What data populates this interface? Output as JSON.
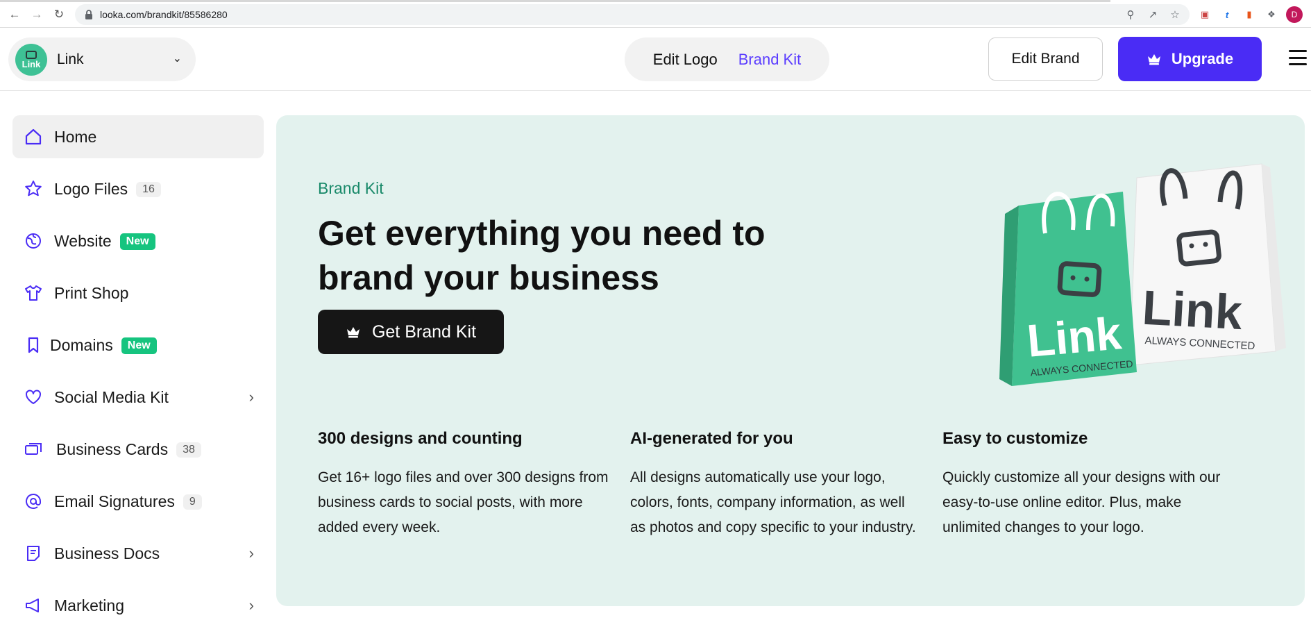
{
  "browser": {
    "url": "looka.com/brandkit/85586280",
    "profile_initial": "D"
  },
  "header": {
    "brand_logo_text": "Link",
    "brand_name": "Link",
    "tabs": [
      {
        "label": "Edit Logo"
      },
      {
        "label": "Brand Kit",
        "active": true
      }
    ],
    "edit_brand_label": "Edit Brand",
    "upgrade_label": "Upgrade",
    "accent_color": "#4a2cf5"
  },
  "sidebar": {
    "items": [
      {
        "label": "Home",
        "icon": "home-icon",
        "active": true
      },
      {
        "label": "Logo Files",
        "icon": "star-icon",
        "badge": "16"
      },
      {
        "label": "Website",
        "icon": "globe-icon",
        "badge": "New"
      },
      {
        "label": "Print Shop",
        "icon": "tshirt-icon"
      },
      {
        "label": "Domains",
        "icon": "bookmark-icon",
        "badge": "New"
      },
      {
        "label": "Social Media Kit",
        "icon": "heart-icon",
        "chevron": true
      },
      {
        "label": "Business Cards",
        "icon": "cards-icon",
        "badge": "38"
      },
      {
        "label": "Email Signatures",
        "icon": "at-icon",
        "badge": "9"
      },
      {
        "label": "Business Docs",
        "icon": "document-icon",
        "chevron": true
      },
      {
        "label": "Marketing",
        "icon": "megaphone-icon",
        "chevron": true
      }
    ]
  },
  "hero": {
    "kicker": "Brand Kit",
    "title_line1": "Get everything you need to",
    "title_line2": "brand your business",
    "cta_label": "Get Brand Kit",
    "bag_green": {
      "brand": "Link",
      "tagline": "ALWAYS CONNECTED"
    },
    "bag_white": {
      "brand": "Link",
      "tagline": "ALWAYS CONNECTED"
    },
    "background": "#e3f2ee"
  },
  "features": [
    {
      "title": "300 designs and counting",
      "body": "Get 16+ logo files and over 300 designs from business cards to social posts, with more added every week."
    },
    {
      "title": "AI-generated for you",
      "body": "All designs automatically use your logo, colors, fonts, company information, as well as photos and copy specific to your industry."
    },
    {
      "title": "Easy to customize",
      "body": "Quickly customize all your designs with our easy-to-use online editor. Plus, make unlimited changes to your logo."
    }
  ]
}
